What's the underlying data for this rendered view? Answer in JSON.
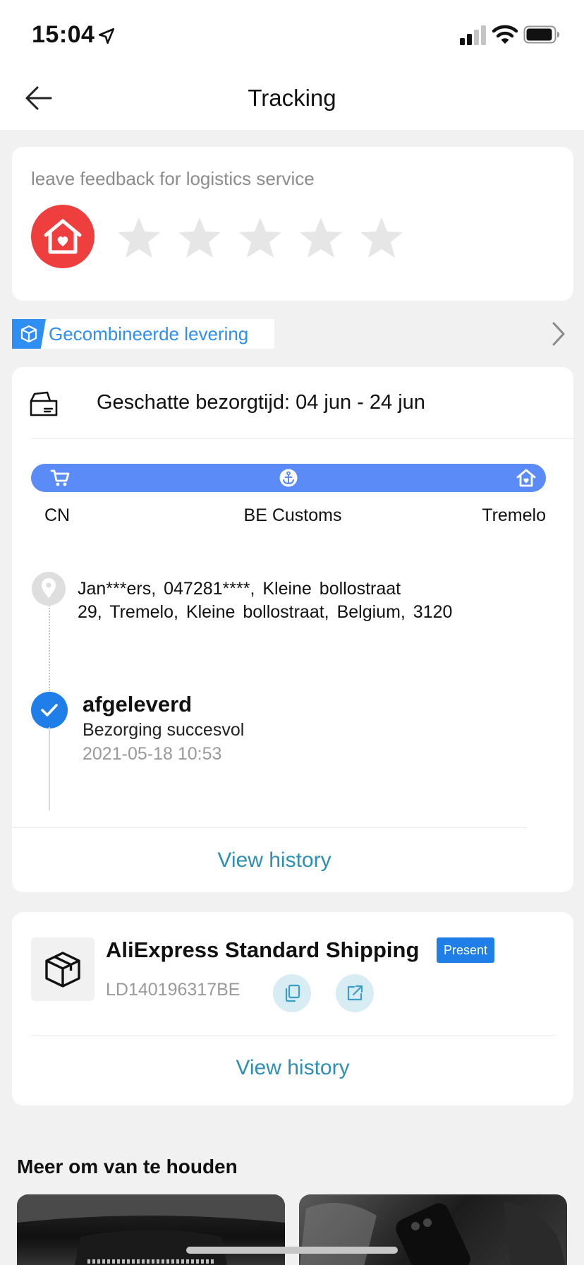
{
  "status_bar": {
    "time": "15:04"
  },
  "nav": {
    "title": "Tracking"
  },
  "feedback": {
    "label": "leave feedback for logistics service",
    "rating": 0,
    "max_rating": 5
  },
  "combined": {
    "label": "Gecombineerde levering"
  },
  "tracking": {
    "eta": "Geschatte bezorgtijd: 04 jun - 24 jun",
    "stages": [
      "CN",
      "BE Customs",
      "Tremelo"
    ],
    "address_line1": "Jan***ers,  047281****,  Kleine bollostraat",
    "address_line2": "29,  Tremelo,  Kleine bollostraat,  Belgium,  3120",
    "status_title": "afgeleverd",
    "status_sub": "Bezorging succesvol",
    "status_time": "2021-05-18 10:53",
    "view_history": "View history"
  },
  "shipping": {
    "carrier": "AliExpress Standard Shipping",
    "badge": "Present",
    "tracking_number": "LD140196317BE",
    "view_history": "View history"
  },
  "recommendations": {
    "title": "Meer om van te houden"
  },
  "colors": {
    "accent_blue": "#1f7ee8",
    "progress_blue": "#5b8bf7",
    "link_teal": "#2d8fb5",
    "badge_red": "#ee3e3e"
  }
}
